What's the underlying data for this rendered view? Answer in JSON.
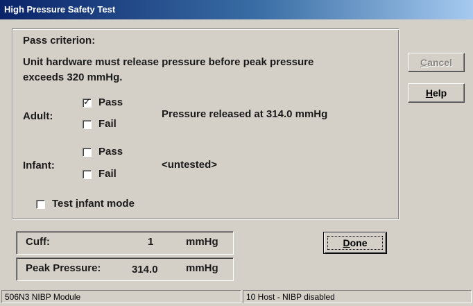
{
  "window": {
    "title": "High Pressure Safety Test"
  },
  "criterion": {
    "heading": "Pass criterion:",
    "line1": "Unit hardware must release pressure before peak pressure",
    "line2": "exceeds 320 mmHg."
  },
  "adult": {
    "label": "Adult:",
    "pass_label": "Pass",
    "pass_checked": true,
    "fail_label": "Fail",
    "fail_checked": false,
    "result": "Pressure released at 314.0 mmHg"
  },
  "infant": {
    "label": "Infant:",
    "pass_label": "Pass",
    "pass_checked": false,
    "fail_label": "Fail",
    "fail_checked": false,
    "result": "<untested>"
  },
  "test_infant_mode": {
    "label_before": "Test ",
    "accel": "i",
    "label_after": "nfant mode",
    "checked": false
  },
  "cuff": {
    "label": "Cuff:",
    "value": "1",
    "unit": "mmHg"
  },
  "peak": {
    "label": "Peak Pressure:",
    "value": "314.0",
    "unit": "mmHg"
  },
  "buttons": {
    "cancel": {
      "accel": "C",
      "rest": "ancel",
      "enabled": false
    },
    "help": {
      "accel": "H",
      "rest": "elp",
      "enabled": true
    },
    "done": {
      "accel": "D",
      "rest": "one",
      "enabled": true
    }
  },
  "status": {
    "left": "506N3 NIBP Module",
    "right": "10 Host - NIBP disabled"
  },
  "check_glyph": "✓"
}
